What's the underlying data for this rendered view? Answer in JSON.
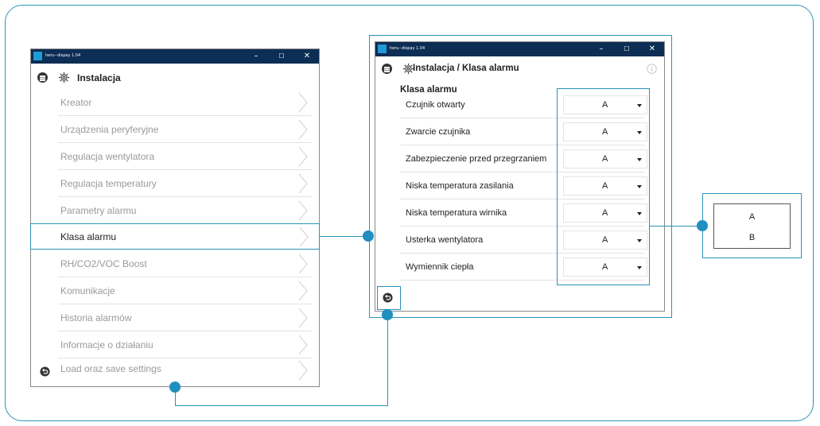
{
  "left_window": {
    "titlebar": {
      "title": "heru--dispay 1.04",
      "minimize": "–",
      "maximize": "☐",
      "close": "✕"
    },
    "header": {
      "title": "Instalacja"
    },
    "menu_items": [
      {
        "label": "Kreator"
      },
      {
        "label": "Urządzenia peryferyjne"
      },
      {
        "label": "Regulacja wentylatora"
      },
      {
        "label": "Regulacja temperatury"
      },
      {
        "label": "Parametry alarmu"
      },
      {
        "label": "Klasa alarmu",
        "active": true
      },
      {
        "label": "RH/CO2/VOC Boost"
      },
      {
        "label": "Komunikacje"
      },
      {
        "label": "Historia alarmów"
      },
      {
        "label": "Informacje o działaniu"
      },
      {
        "label": "Load oraz save settings"
      }
    ]
  },
  "right_window": {
    "titlebar": {
      "title": "heru--dispay 1.04",
      "minimize": "–",
      "maximize": "☐",
      "close": "✕"
    },
    "header": {
      "title": "Instalacja / Klasa alarmu",
      "info_icon": "info-icon"
    },
    "section_title": "Klasa alarmu",
    "settings": [
      {
        "label": "Czujnik otwarty",
        "value": "A"
      },
      {
        "label": "Zwarcie czujnika",
        "value": "A"
      },
      {
        "label": "Zabezpieczenie przed przegrzaniem",
        "value": "A"
      },
      {
        "label": "Niska temperatura zasilania",
        "value": "A"
      },
      {
        "label": "Niska temperatura wirnika",
        "value": "A"
      },
      {
        "label": "Usterka wentylatora",
        "value": "A"
      },
      {
        "label": "Wymiennik ciepła",
        "value": "A"
      }
    ]
  },
  "dropdown_options": [
    "A",
    "B"
  ],
  "colors": {
    "accent": "#2a93b8",
    "dot": "#1f8fbf",
    "titlebar": "#0c2d54",
    "app_icon": "#1f9ad6"
  }
}
